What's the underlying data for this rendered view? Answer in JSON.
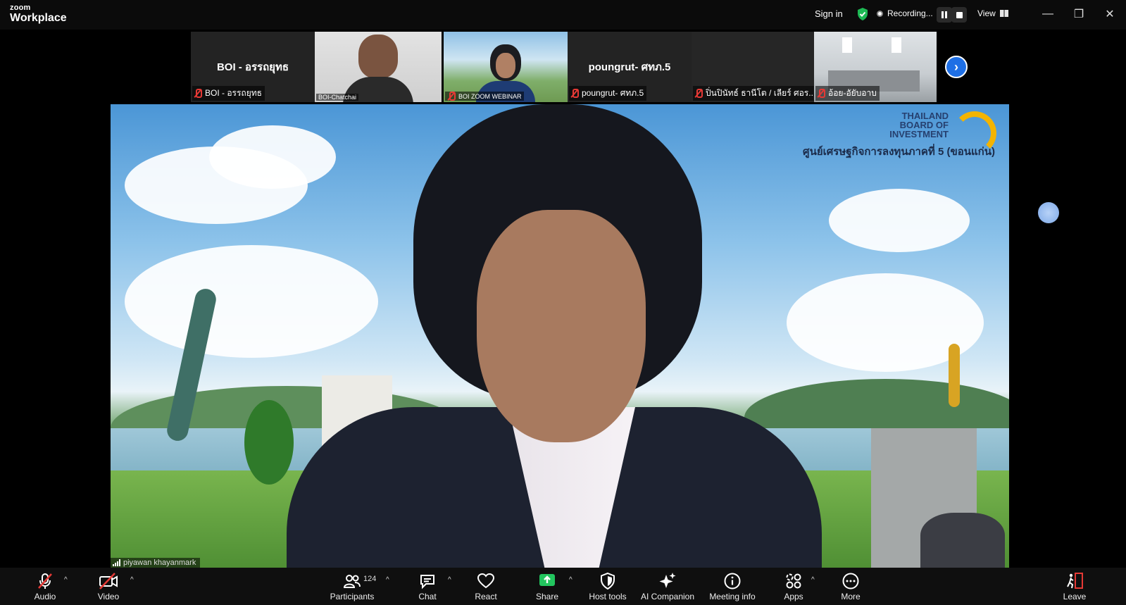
{
  "app": {
    "brand_line1": "zoom",
    "brand_line2": "Workplace"
  },
  "topbar": {
    "sign_in": "Sign in",
    "recording_label": "Recording...",
    "view_label": "View",
    "secure_icon": "shield-check-icon",
    "accent_green": "#1db954"
  },
  "participants_strip": [
    {
      "big_name": "BOI - อรรถยุทธ",
      "name": "BOI - อรรถยุทธ",
      "muted": true,
      "has_video": false
    },
    {
      "name": "BOI-Chatchai",
      "muted": false,
      "has_video": true
    },
    {
      "name": "BOI ZOOM WEBINAR",
      "muted": true,
      "has_video": true
    },
    {
      "big_name": "poungrut-  ศทภ.5",
      "name": "poungrut-  ศทภ.5",
      "muted": true,
      "has_video": false
    },
    {
      "name": "ปิ่นปินัทธ์ ธานีโต / เลียร์ ศอร...",
      "muted": true,
      "has_video": false
    },
    {
      "name": "อ้อย-อัยับอาบ",
      "muted": true,
      "has_video": true
    }
  ],
  "main_video": {
    "speaker_name": "piyawan khayanmark",
    "logo_lines": [
      "THAILAND",
      "BOARD OF",
      "INVESTMENT"
    ],
    "logo_subtitle": "ศูนย์เศรษฐกิจการลงทุนภาคที่ 5 (ขอนแก่น)"
  },
  "toolbar": {
    "audio": "Audio",
    "video": "Video",
    "participants": "Participants",
    "participants_count": "124",
    "chat": "Chat",
    "react": "React",
    "share": "Share",
    "host_tools": "Host tools",
    "ai_companion": "AI Companion",
    "meeting_info": "Meeting info",
    "apps": "Apps",
    "more": "More",
    "leave": "Leave",
    "colors": {
      "mute_red": "#e53935",
      "share_green": "#22c55e",
      "leave_red": "#e53935",
      "next_blue": "#1e6fe5"
    }
  }
}
